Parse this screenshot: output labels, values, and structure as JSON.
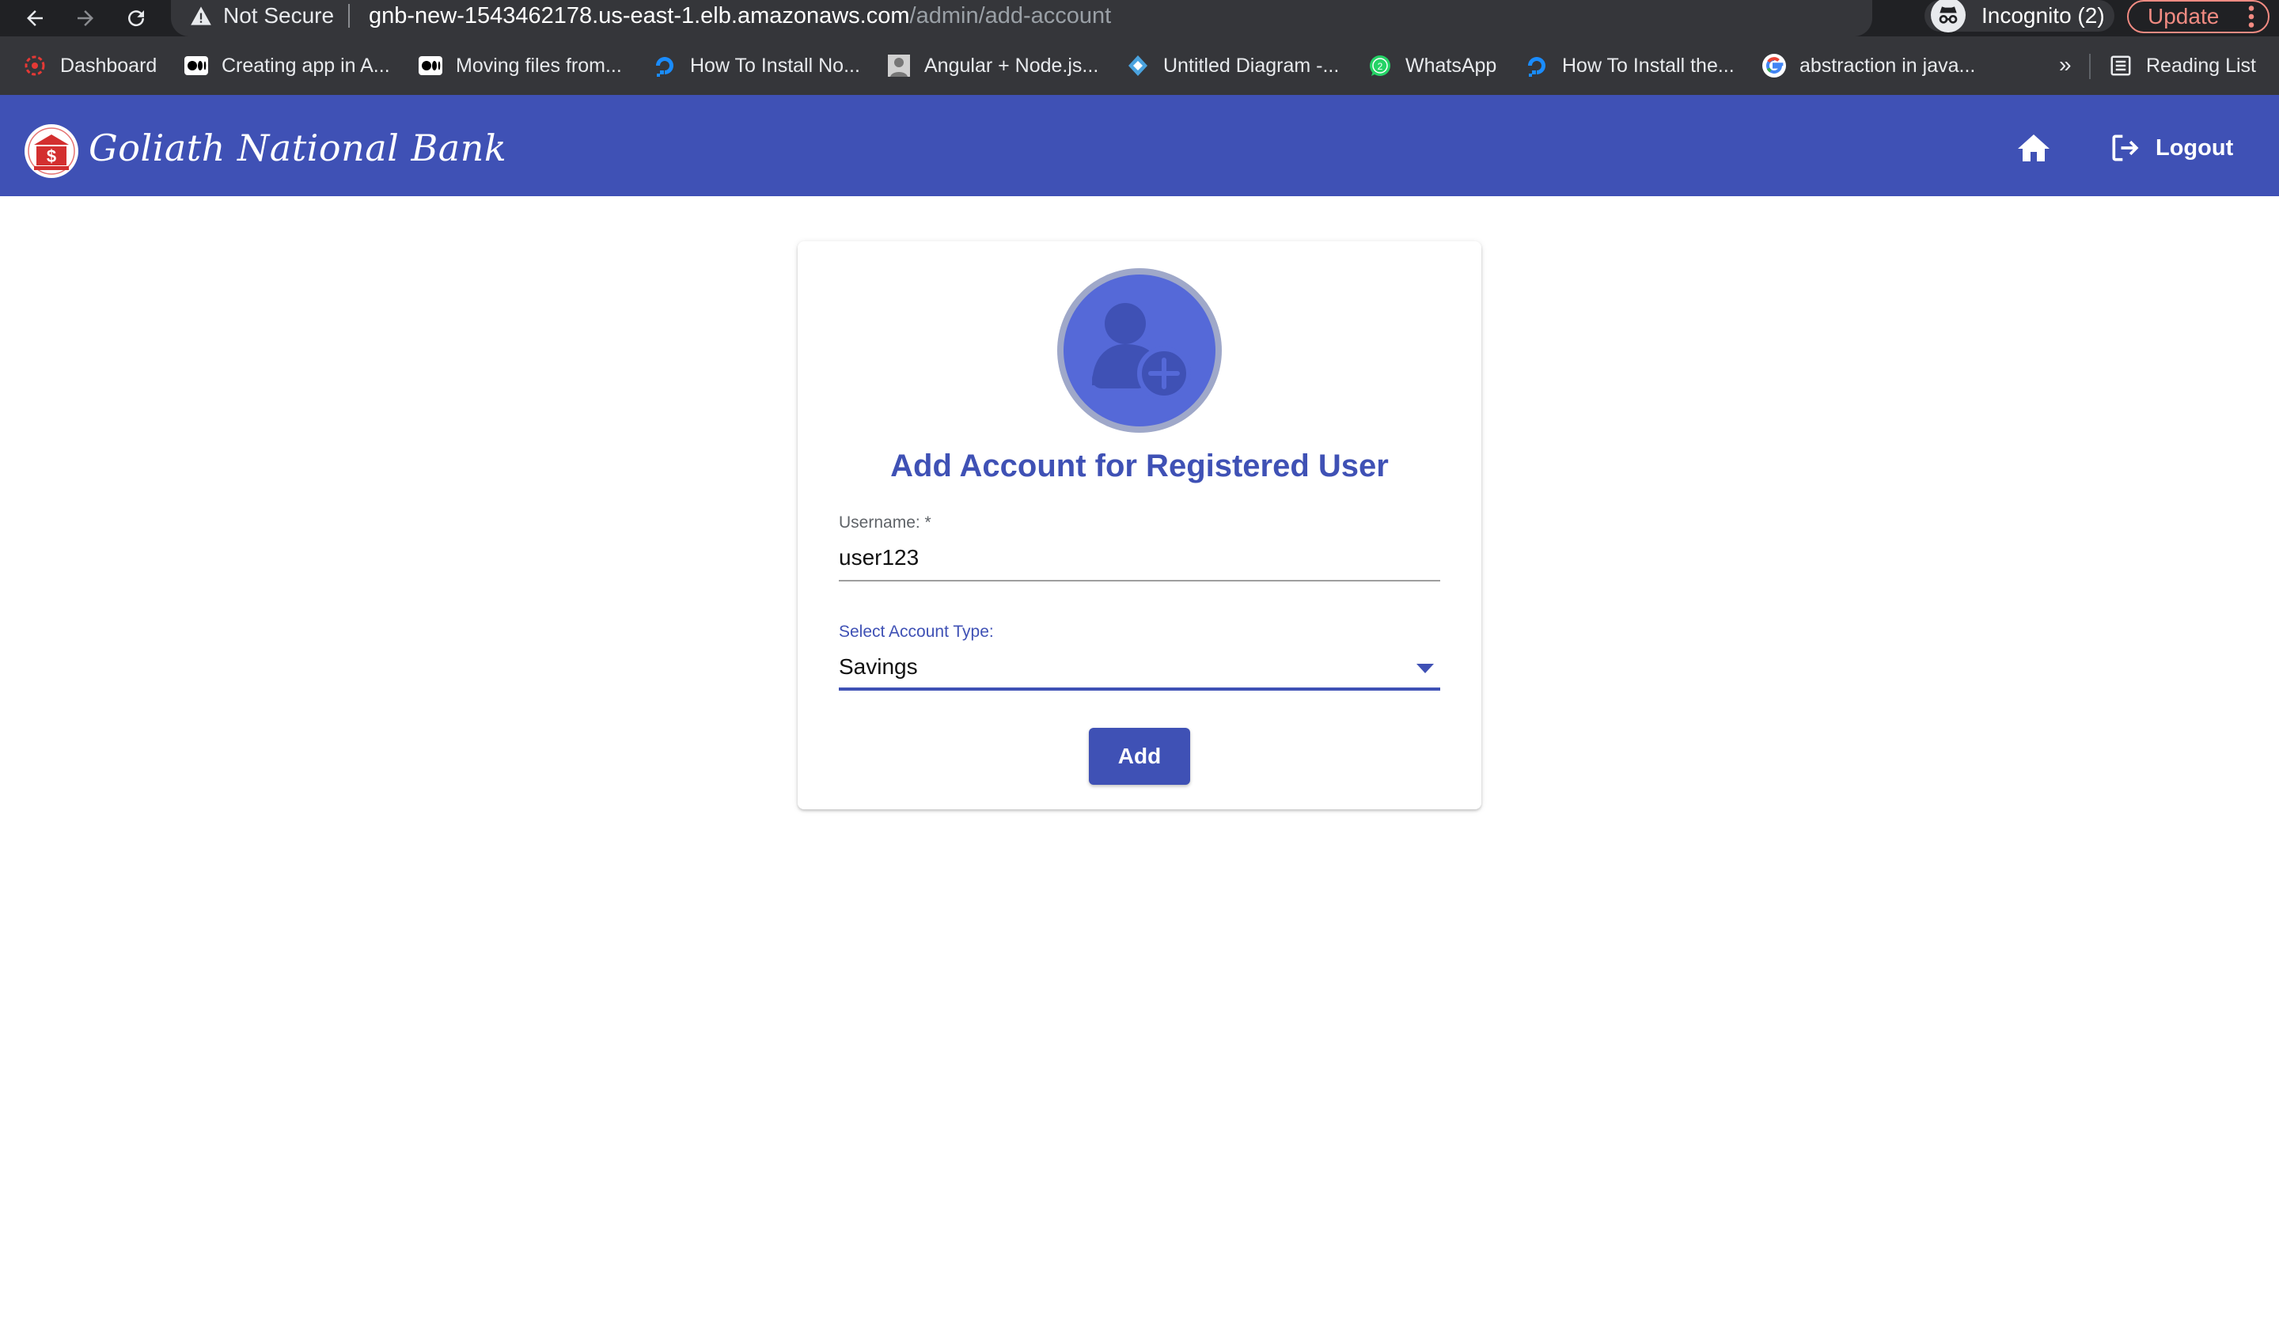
{
  "browser": {
    "security_label": "Not Secure",
    "url_host": "gnb-new-1543462178.us-east-1.elb.amazonaws.com",
    "url_path": "/admin/add-account",
    "incognito_label": "Incognito (2)",
    "update_label": "Update",
    "bookmarks": [
      {
        "label": "Dashboard",
        "icon": "dashboard-logo-icon"
      },
      {
        "label": "Creating app in A...",
        "icon": "medium-icon"
      },
      {
        "label": "Moving files from...",
        "icon": "medium-icon"
      },
      {
        "label": "How To Install No...",
        "icon": "digitalocean-icon"
      },
      {
        "label": "Angular + Node.js...",
        "icon": "avatar-icon"
      },
      {
        "label": "Untitled Diagram -...",
        "icon": "diagram-icon"
      },
      {
        "label": "WhatsApp",
        "icon": "whatsapp-icon"
      },
      {
        "label": "How To Install the...",
        "icon": "digitalocean-icon"
      },
      {
        "label": "abstraction in java...",
        "icon": "google-icon"
      }
    ],
    "bookmarks_overflow": "»",
    "reading_list_label": "Reading List"
  },
  "app": {
    "brand": "Goliath National Bank",
    "logout_label": "Logout",
    "colors": {
      "primary": "#3f51b5",
      "avatar": "#5569d8"
    }
  },
  "form": {
    "title": "Add Account for Registered User",
    "username_label": "Username: *",
    "username_value": "user123",
    "account_type_label": "Select Account Type:",
    "account_type_value": "Savings",
    "submit_label": "Add"
  }
}
